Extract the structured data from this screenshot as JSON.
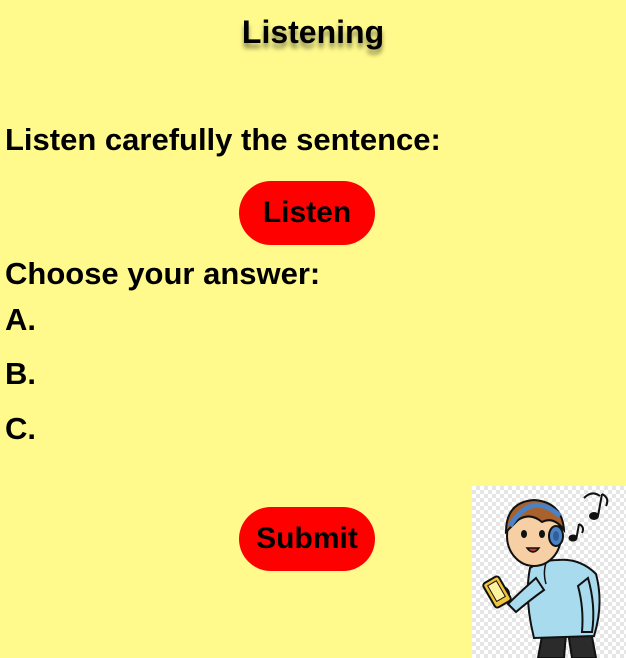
{
  "header": {
    "title": "Listening"
  },
  "main": {
    "listen_prompt": "Listen carefully the sentence:",
    "listen_button_label": "Listen",
    "choose_prompt": "Choose your answer:",
    "options": [
      {
        "label": "A."
      },
      {
        "label": "B."
      },
      {
        "label": "C."
      }
    ],
    "submit_button_label": "Submit"
  },
  "illustration": {
    "icon": "boy-listening-headphones-icon"
  },
  "colors": {
    "background": "#fffa8b",
    "button": "#ff0000"
  }
}
